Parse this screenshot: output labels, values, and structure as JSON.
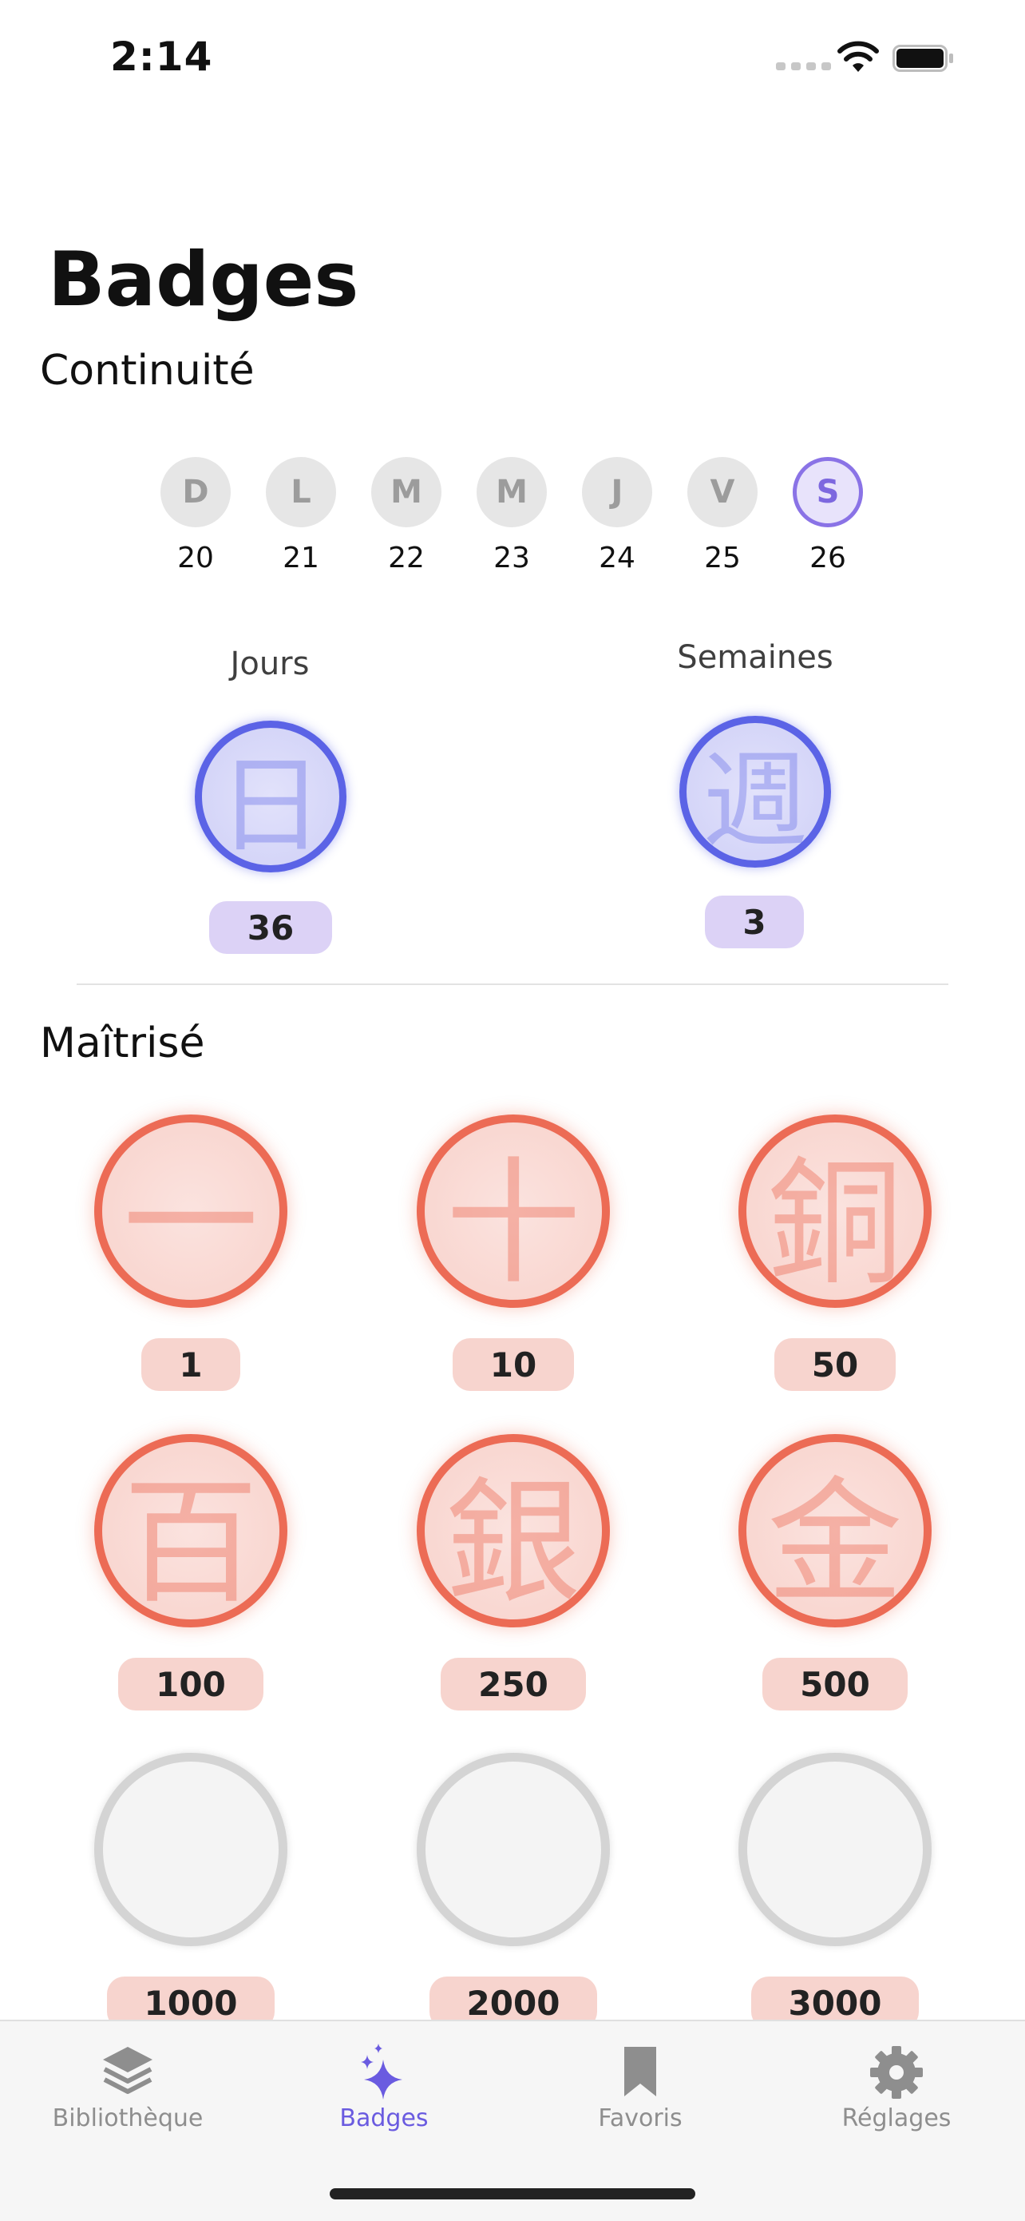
{
  "status_bar": {
    "time": "2:14"
  },
  "page": {
    "title": "Badges"
  },
  "continuity": {
    "heading": "Continuité",
    "days": [
      {
        "letter": "D",
        "date": "20",
        "active": false
      },
      {
        "letter": "L",
        "date": "21",
        "active": false
      },
      {
        "letter": "M",
        "date": "22",
        "active": false
      },
      {
        "letter": "M",
        "date": "23",
        "active": false
      },
      {
        "letter": "J",
        "date": "24",
        "active": false
      },
      {
        "letter": "V",
        "date": "25",
        "active": false
      },
      {
        "letter": "S",
        "date": "26",
        "active": true
      }
    ],
    "days_streak": {
      "label": "Jours",
      "glyph": "日",
      "value": "36"
    },
    "weeks_streak": {
      "label": "Semaines",
      "glyph": "週",
      "value": "3"
    }
  },
  "mastered": {
    "heading": "Maîtrisé",
    "badges": [
      {
        "glyph": "一",
        "value": "1",
        "earned": true
      },
      {
        "glyph": "十",
        "value": "10",
        "earned": true
      },
      {
        "glyph": "銅",
        "value": "50",
        "earned": true
      },
      {
        "glyph": "百",
        "value": "100",
        "earned": true
      },
      {
        "glyph": "銀",
        "value": "250",
        "earned": true
      },
      {
        "glyph": "金",
        "value": "500",
        "earned": true
      },
      {
        "glyph": "",
        "value": "1000",
        "earned": false
      },
      {
        "glyph": "",
        "value": "2000",
        "earned": false
      },
      {
        "glyph": "",
        "value": "3000",
        "earned": false
      }
    ]
  },
  "tabbar": {
    "tabs": [
      {
        "label": "Bibliothèque",
        "icon": "layers-icon",
        "active": false
      },
      {
        "label": "Badges",
        "icon": "sparkles-icon",
        "active": true
      },
      {
        "label": "Favoris",
        "icon": "bookmark-icon",
        "active": false
      },
      {
        "label": "Réglages",
        "icon": "gear-icon",
        "active": false
      }
    ]
  },
  "colors": {
    "accent": "#6a5be0",
    "streak_blue": "#5b63e6",
    "mastered_red": "#ec6b55",
    "locked_gray": "#d4d4d4"
  }
}
